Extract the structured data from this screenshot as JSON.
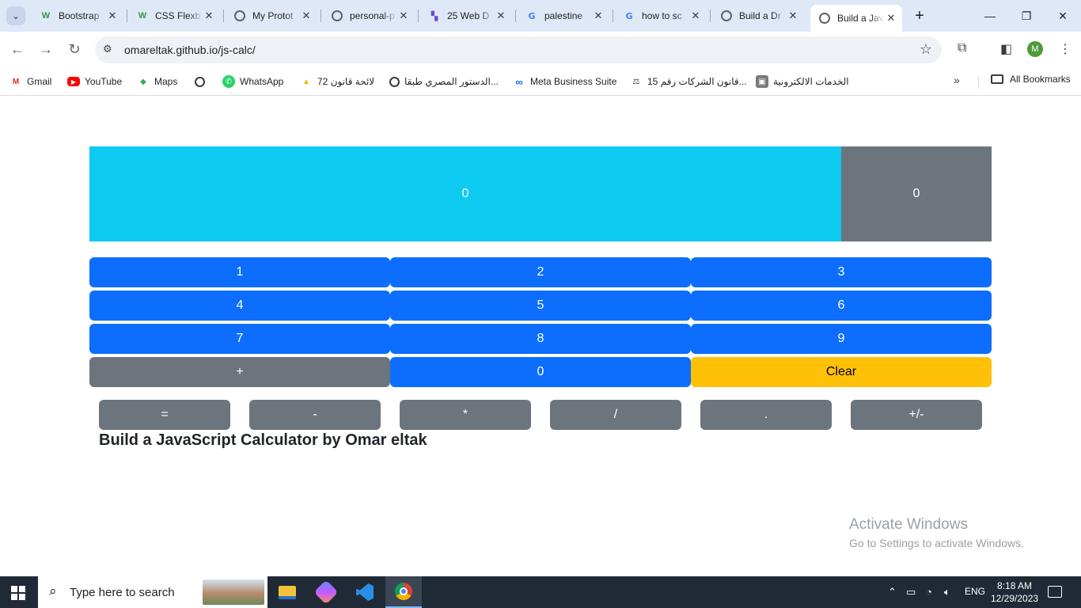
{
  "browser": {
    "tabs": [
      {
        "title": "Bootstrap",
        "icon": "w-icon"
      },
      {
        "title": "CSS Flexb",
        "icon": "w-icon"
      },
      {
        "title": "My Protot",
        "icon": "globe-icon"
      },
      {
        "title": "personal-p",
        "icon": "globe-icon"
      },
      {
        "title": "25 Web D",
        "icon": "hashnode-icon"
      },
      {
        "title": "palestine",
        "icon": "google-icon"
      },
      {
        "title": "how to sc",
        "icon": "google-icon"
      },
      {
        "title": "Build a Dr",
        "icon": "globe-icon"
      },
      {
        "title": "Build a Jav",
        "icon": "globe-icon",
        "active": true
      }
    ],
    "url": "omareltak.github.io/js-calc/",
    "profile_initial": "M",
    "bookmarks": [
      {
        "label": "Gmail",
        "icon": "gmail-icon"
      },
      {
        "label": "YouTube",
        "icon": "youtube-icon"
      },
      {
        "label": "Maps",
        "icon": "maps-icon"
      },
      {
        "label": "",
        "icon": "globe-icon"
      },
      {
        "label": "WhatsApp",
        "icon": "whatsapp-icon"
      },
      {
        "label": "لائحة قانون 72",
        "icon": "drive-icon"
      },
      {
        "label": "الدستور المصري طبقا...",
        "icon": "globe-icon"
      },
      {
        "label": "Meta Business Suite",
        "icon": "meta-icon"
      },
      {
        "label": "قانون الشركات رقم 15...",
        "icon": "gavel-icon"
      },
      {
        "label": "الخدمات الالكترونية",
        "icon": "gov-icon"
      }
    ],
    "all_bookmarks_label": "All Bookmarks"
  },
  "calculator": {
    "display_main": "0",
    "display_secondary": "0",
    "rows": [
      [
        "1",
        "2",
        "3"
      ],
      [
        "4",
        "5",
        "6"
      ],
      [
        "7",
        "8",
        "9"
      ],
      [
        "+",
        "0",
        "Clear"
      ]
    ],
    "operators": [
      "=",
      "-",
      "*",
      "/",
      ".",
      "+/-"
    ],
    "credit": "Build a JavaScript Calculator by Omar eltak"
  },
  "watermark": {
    "line1": "Activate Windows",
    "line2": "Go to Settings to activate Windows."
  },
  "taskbar": {
    "search_placeholder": "Type here to search",
    "language": "ENG",
    "time": "8:18 AM",
    "date": "12/29/2023"
  },
  "colors": {
    "display_main_bg": "#0dcaf0",
    "display_secondary_bg": "#6c757d",
    "key_blue": "#0d6efd",
    "key_gray": "#6c757d",
    "key_yellow": "#ffc107"
  }
}
